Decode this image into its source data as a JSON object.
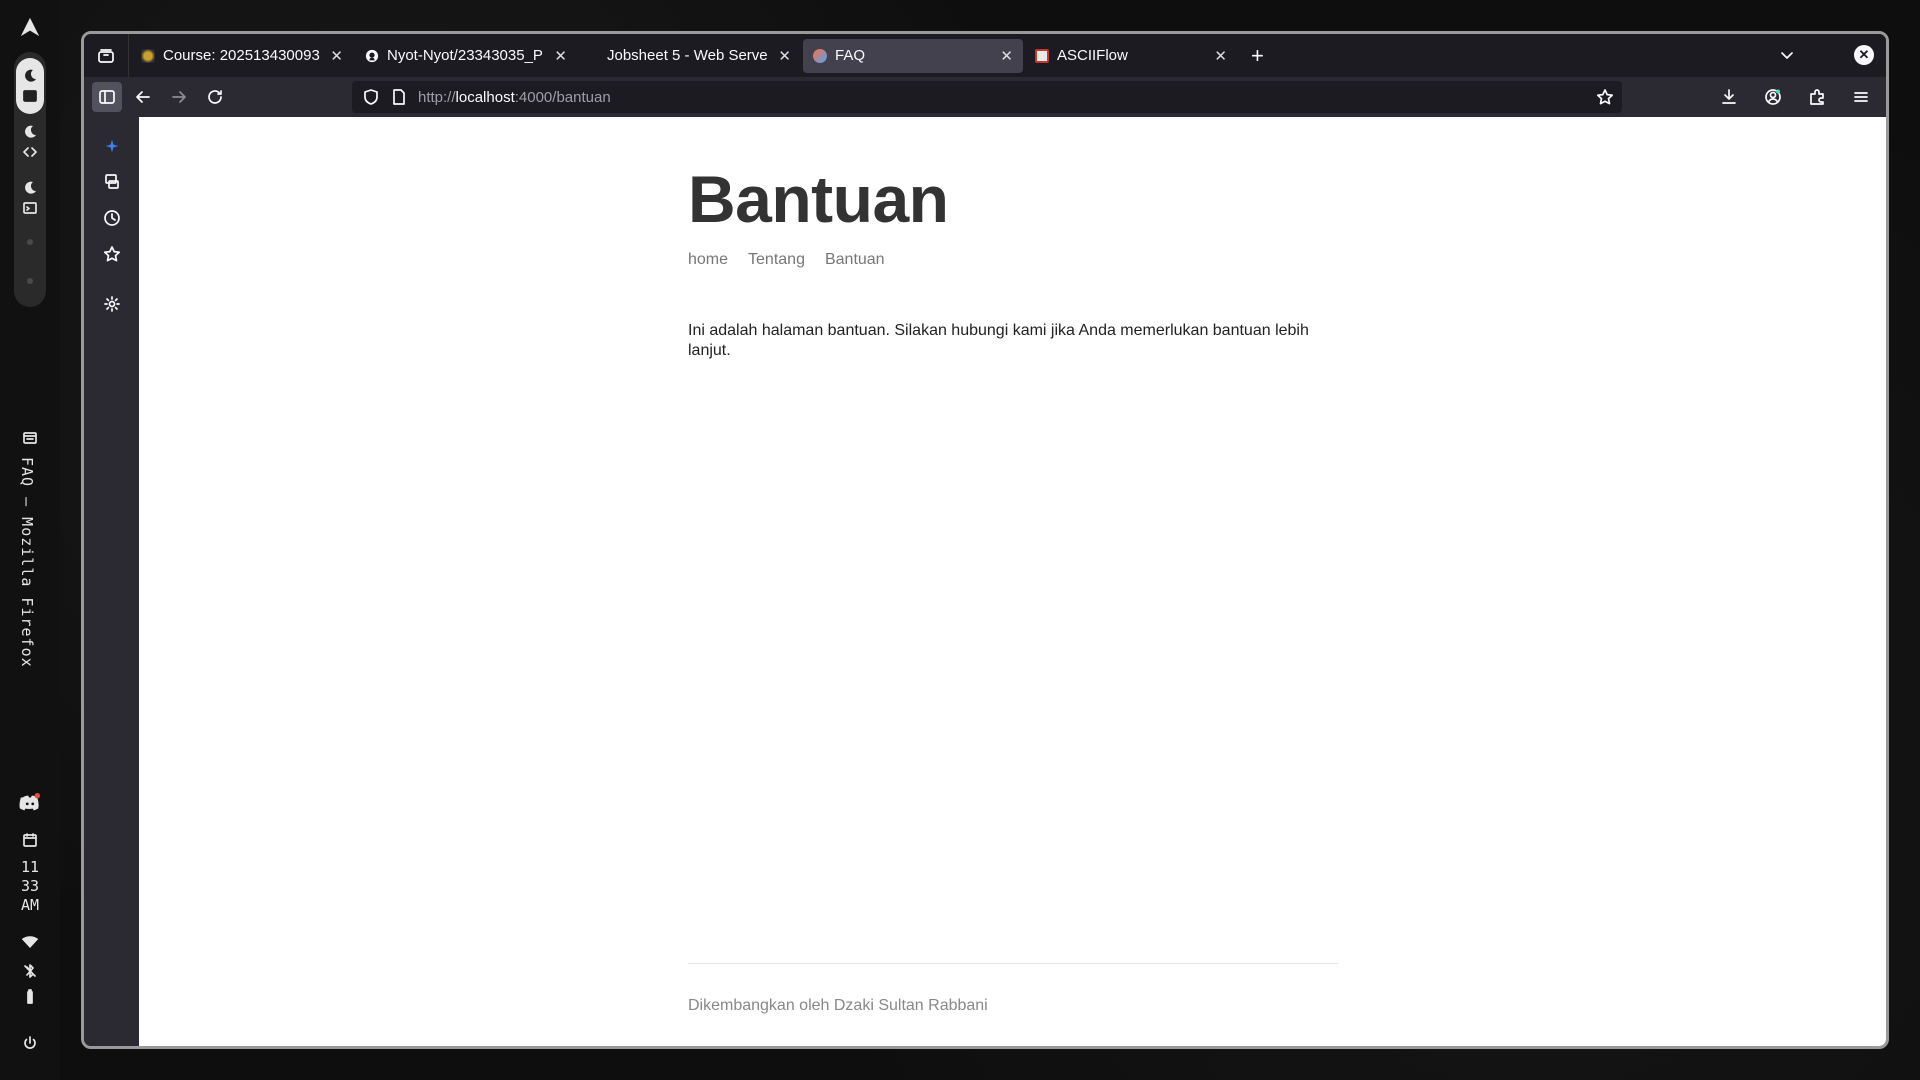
{
  "system": {
    "window_title": "FAQ – Mozilla Firefox",
    "clock": [
      "11",
      "33",
      "AM"
    ]
  },
  "tabs": [
    {
      "label": "Course: 202513430093",
      "favicon_color": "#c9a227",
      "icon": "moodle-favicon"
    },
    {
      "label": "Nyot-Nyot/23343035_P",
      "favicon_color": "#ffffff",
      "icon": "github-favicon"
    },
    {
      "label": "Jobsheet 5 - Web Serve",
      "favicon_color": "",
      "icon": "none"
    },
    {
      "label": "FAQ",
      "favicon_color": "#ff7139",
      "icon": "firefox-favicon",
      "active": true
    },
    {
      "label": "ASCIIFlow",
      "favicon_color": "#e8e8e8",
      "icon": "asciiflow-favicon"
    }
  ],
  "url": {
    "scheme": "http://",
    "host": "localhost",
    "rest": ":4000/bantuan"
  },
  "page": {
    "title": "Bantuan",
    "nav": [
      "home",
      "Tentang",
      "Bantuan"
    ],
    "body": "Ini adalah halaman bantuan. Silakan hubungi kami jika Anda memerlukan bantuan lebih lanjut.",
    "footer": "Dikembangkan oleh Dzaki Sultan Rabbani"
  },
  "colors": {
    "tabbar": "#1c1b22",
    "toolbar": "#2b2a33",
    "page_bg": "#ffffff",
    "title_text": "#333333",
    "accent": "#3b82f6"
  }
}
